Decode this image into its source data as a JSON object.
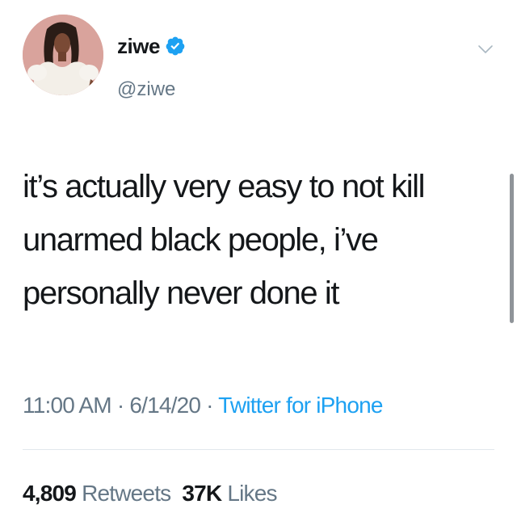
{
  "tweet": {
    "display_name": "ziwe",
    "verified": true,
    "handle": "@ziwe",
    "text": "it’s actually very easy to not kill\nunarmed black people, i’ve\npersonally never done it",
    "time": "11:00 AM",
    "date": "6/14/20",
    "separator": "·",
    "source": "Twitter for iPhone",
    "retweets_count": "4,809",
    "retweets_label": "Retweets",
    "likes_count": "37K",
    "likes_label": "Likes"
  },
  "icons": {
    "verified": "verified-badge-icon",
    "more": "chevron-down-icon"
  },
  "colors": {
    "text": "#14171a",
    "secondary": "#657786",
    "accent": "#1da1f2",
    "avatar_bg": "#d9a39c"
  }
}
